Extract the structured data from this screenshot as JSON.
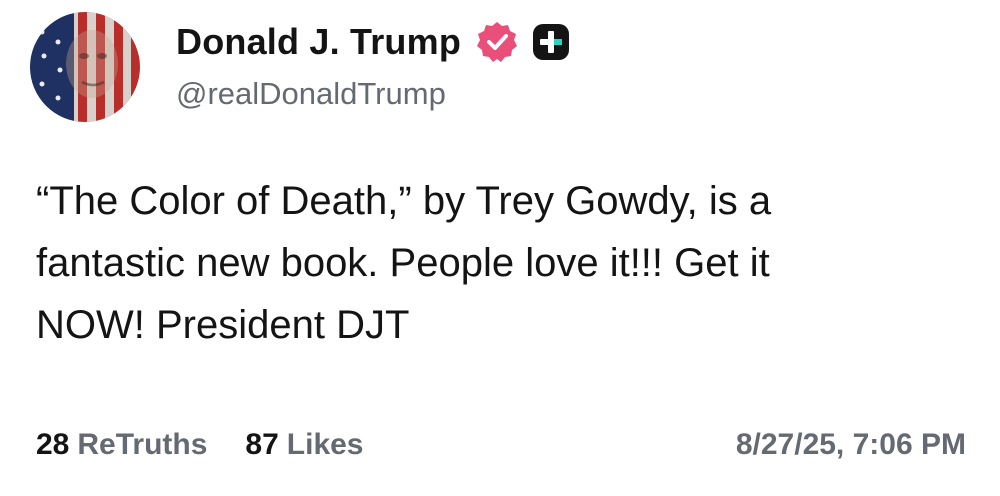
{
  "author": {
    "display_name": "Donald J. Trump",
    "handle": "@realDonaldTrump",
    "avatar_icon": "flag-portrait-avatar",
    "verified_icon": "verified-badge-icon",
    "plus_icon": "plus-badge-icon",
    "verified_color": "#ea4f7a"
  },
  "post": {
    "lines": [
      "“The Color of Death,” by Trey Gowdy, is a",
      "fantastic new book. People love it!!! Get it",
      "NOW! President DJT"
    ]
  },
  "stats": {
    "retruths_count": "28",
    "retruths_label": "ReTruths",
    "likes_count": "87",
    "likes_label": "Likes"
  },
  "timestamp": "8/27/25, 7:06 PM",
  "colors": {
    "text": "#141414",
    "muted": "#656a72",
    "background": "#ffffff"
  }
}
